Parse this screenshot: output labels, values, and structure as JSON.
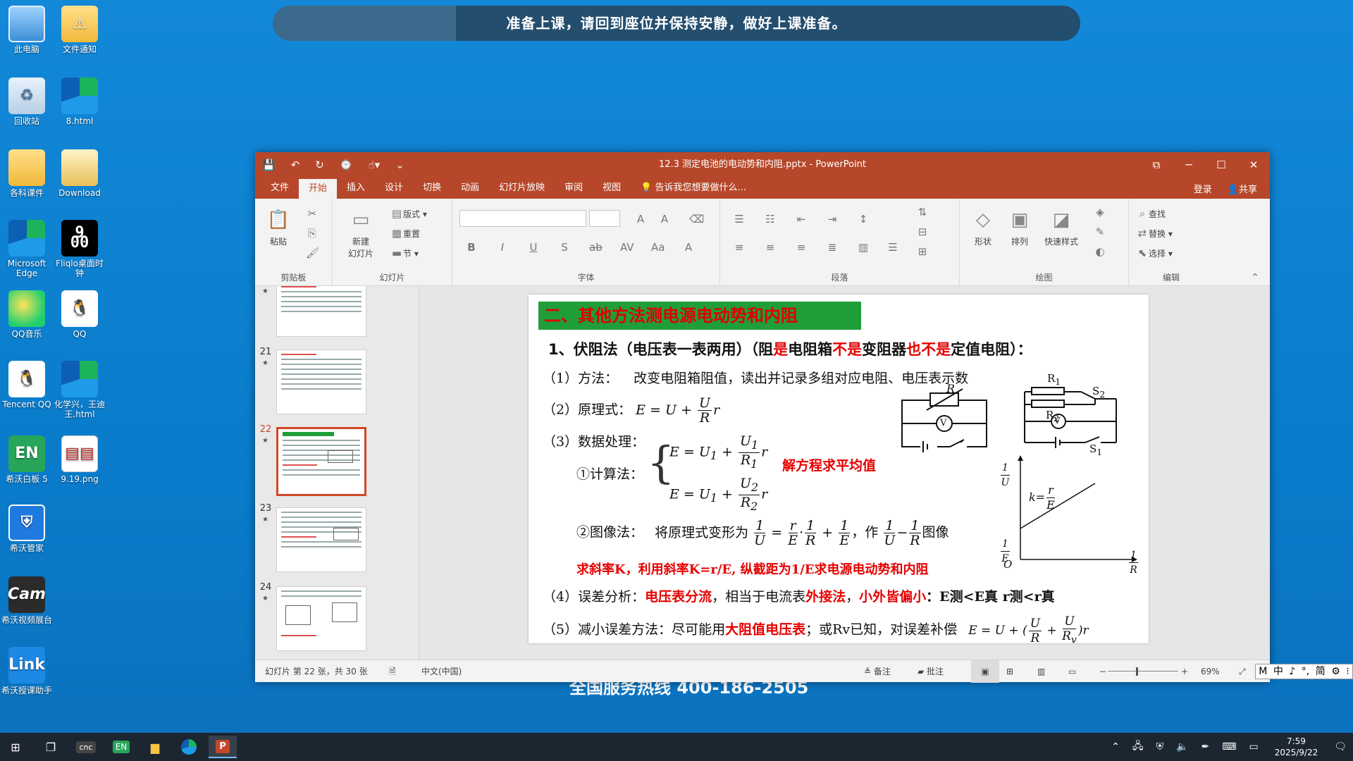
{
  "desktop": {
    "icons": [
      {
        "label": "此电脑"
      },
      {
        "label": "文件通知"
      },
      {
        "label": "回收站"
      },
      {
        "label": "8.html"
      },
      {
        "label": "各科课件"
      },
      {
        "label": "Download"
      },
      {
        "label": "Microsoft Edge"
      },
      {
        "label": "Fliqlo桌面时钟"
      },
      {
        "label": "QQ音乐"
      },
      {
        "label": "QQ"
      },
      {
        "label": "Tencent QQ"
      },
      {
        "label": "化学兴，王迪王.html"
      },
      {
        "label": "希沃白板 5"
      },
      {
        "label": "9.19.png"
      },
      {
        "label": "希沃管家"
      },
      {
        "label": "希沃视频展台"
      },
      {
        "label": "希沃授课助手"
      }
    ],
    "clock_glyph": "9 00",
    "banner": "准备上课，请回到座位并保持安静，做好上课准备。",
    "hotline": "全国服务热线 400-186-2505"
  },
  "window": {
    "title": "12.3  测定电池的电动势和内阻.pptx - PowerPoint",
    "tabs": [
      "文件",
      "开始",
      "插入",
      "设计",
      "切换",
      "动画",
      "幻灯片放映",
      "审阅",
      "视图"
    ],
    "active_tab": "开始",
    "tell_me": "告诉我您想要做什么...",
    "login": "登录",
    "share": "共享"
  },
  "ribbon": {
    "paste": "粘贴",
    "clipboard": "剪贴板",
    "new_slide": "新建\n幻灯片",
    "layout": "版式",
    "reset": "重置",
    "section": "节",
    "slides_group": "幻灯片",
    "font_group": "字体",
    "paragraph_group": "段落",
    "shapes": "形状",
    "arrange": "排列",
    "quick_styles": "快速样式",
    "drawing_group": "绘图",
    "find": "查找",
    "replace": "替换",
    "select": "选择",
    "editing_group": "编辑"
  },
  "thumbnails": [
    {
      "num": "",
      "star": "★"
    },
    {
      "num": "21",
      "star": "★"
    },
    {
      "num": "22",
      "star": "★"
    },
    {
      "num": "23",
      "star": "★"
    },
    {
      "num": "24",
      "star": "★"
    }
  ],
  "slide": {
    "title": "二、其他方法测电源电动势和内阻",
    "heading_a": "1、伏阻法（电压表一表两用）（阻",
    "heading_b": "是",
    "heading_c": "电阻箱",
    "heading_d": "不是",
    "heading_e": "变阻器",
    "heading_f": "也不是",
    "heading_g": "定值电阻）：",
    "line1_label": "（1）方法：",
    "line1_text": "改变电阻箱阻值，读出并记录多组对应电阻、电压表示数",
    "line2_label": "（2）原理式：",
    "line3_label": "（3）数据处理：",
    "calc_label": "①计算法：",
    "calc_note": "解方程求平均值",
    "graph_label": "②图像法：",
    "graph_text": "将原理式变形为",
    "graph_tail": "，作",
    "graph_end": "图像",
    "slope_note": "求斜率K，利用斜率K=r/E, 纵截距为1/E求电源电动势和内阻",
    "err_label": "（4）误差分析：",
    "err_a": "电压表分流",
    "err_b": "，相当于电流表",
    "err_c": "外接法",
    "err_d": "，",
    "err_e": "小外皆偏小",
    "err_f": "：E测<E真   r测<r真",
    "fix_label": "（5）减小误差方法：尽可能用",
    "fix_a": "大阻值电压表",
    "fix_b": "；或Rv已知，对误差补偿"
  },
  "status": {
    "slide_info": "幻灯片 第 22 张，共 30 张",
    "language": "中文(中国)",
    "notes": "备注",
    "comments": "批注",
    "zoom": "69%"
  },
  "ime": [
    "M",
    "中",
    "♪",
    "°,",
    "简",
    "⚙",
    "⁝"
  ],
  "taskbar": {
    "time": "7:59",
    "date": "2025/9/22"
  }
}
